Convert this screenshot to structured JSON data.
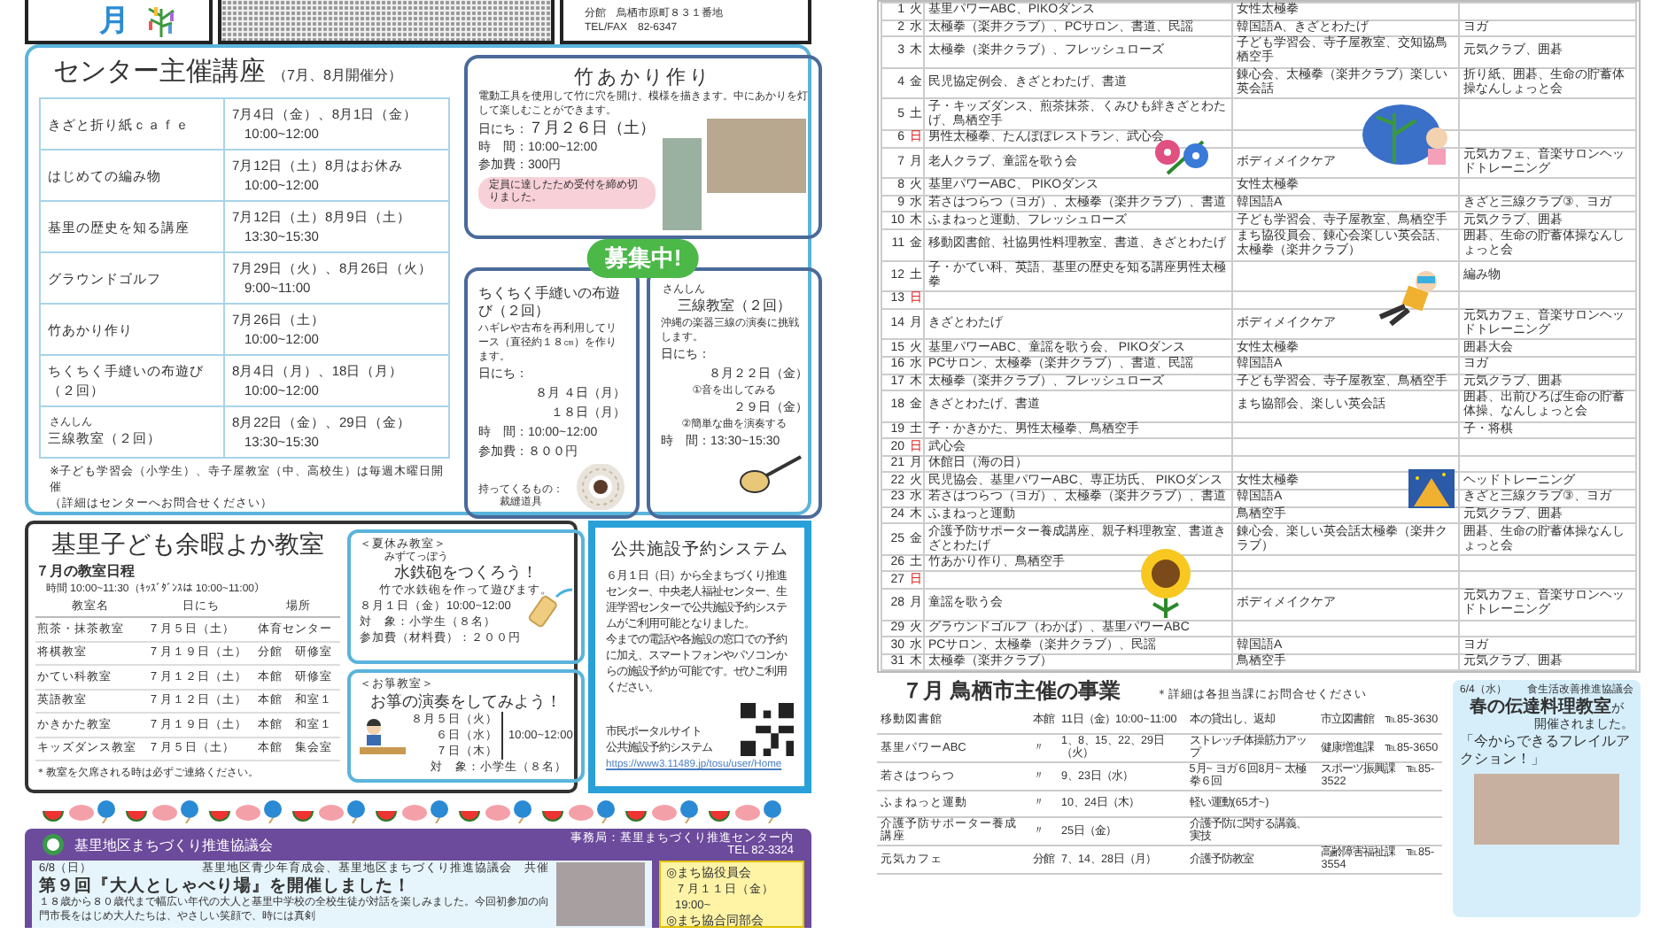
{
  "header": {
    "month": "月",
    "address": "分館　鳥栖市原町８３１番地",
    "tel": "TEL/FAX　82-6347"
  },
  "center_courses": {
    "title": "センター主催講座",
    "subtitle": "（7月、8月開催分）",
    "rows": [
      {
        "name": "きざと折り紙ｃａｆｅ",
        "dates": "7月4日（金）、8月1日（金）",
        "time": "10:00~12:00"
      },
      {
        "name": "はじめての編み物",
        "dates": "7月12日（土）8月はお休み",
        "time": "10:00~12:00"
      },
      {
        "name": "基里の歴史を知る講座",
        "dates": "7月12日（土）8月9日（土）",
        "time": "13:30~15:30"
      },
      {
        "name": "グラウンドゴルフ",
        "dates": "7月29日（火）、8月26日（火）",
        "time": "9:00~11:00"
      },
      {
        "name": "竹あかり作り",
        "dates": "7月26日（土）",
        "time": "10:00~12:00"
      },
      {
        "name": "ちくちく手縫いの布遊び（２回）",
        "dates": "8月4日（月）、18日（月）",
        "time": "10:00~12:00"
      },
      {
        "name_base": "三線",
        "name_ruby": "さんしん",
        "name": "教室（２回）",
        "dates": "8月22日（金）、29日（金）",
        "time": "13:30~15:30"
      }
    ],
    "notes": [
      "※子ども学習会（小学生）、寺子屋教室（中、高校生）は毎週木曜日開催",
      "（詳細はセンターへお問合せください）"
    ],
    "bamboo": {
      "title": "竹あかり作り",
      "desc": "電動工具を使用して竹に穴を開け、模様を描きます。中にあかりを灯して楽しむことができます。",
      "date_label": "日にち：",
      "date": "７月２６日（土）",
      "time": "時　間：10:00~12:00",
      "fee": "参加費：300円",
      "closed_note": "定員に達したため受付を締め切りました。"
    },
    "badge": "募集中!",
    "sewing": {
      "title": "ちくちく手縫いの布遊び（２回）",
      "desc": "ハギレや古布を再利用してリース（直径約１８㎝）を作ります。",
      "date_label": "日にち：",
      "dates": [
        "８月 ４日（月）",
        "１８日（月）"
      ],
      "time": "時　間：10:00~12:00",
      "fee": "参加費：８００円",
      "bring": "持ってくるもの：",
      "bring_item": "裁縫道具"
    },
    "sanshin": {
      "title_base": "三線",
      "title_ruby": "さんしん",
      "title": "教室（２回）",
      "desc": "沖縄の楽器三線の演奏に挑戦します。",
      "date_label": "日にち：",
      "sessions": [
        {
          "date": "８月２２日（金）",
          "note": "①音を出してみる"
        },
        {
          "date": "２９日（金）",
          "note": "②簡単な曲を演奏する"
        }
      ],
      "time": "時　間：13:30~15:30"
    }
  },
  "kids_classes": {
    "title": "基里子ども余暇よか教室",
    "subtitle": "７月の教室日程",
    "hours": "時間 10:00~11:30（ｷｯｽﾞﾀﾞﾝｽは 10:00~11:00）",
    "columns": [
      "教室名",
      "日にち",
      "場所"
    ],
    "rows": [
      [
        "煎茶・抹茶教室",
        "７月５日（土）",
        "体育センター"
      ],
      [
        "将棋教室",
        "７月１９日（土）",
        "分館　研修室"
      ],
      [
        "かてい科教室",
        "７月１２日（土）",
        "本館　研修室"
      ],
      [
        "英語教室",
        "７月１２日（土）",
        "本館　和室１"
      ],
      [
        "かきかた教室",
        "７月１９日（土）",
        "本館　和室１"
      ],
      [
        "キッズダンス教室",
        "７月５日（土）",
        "本館　集会室"
      ]
    ],
    "note": "＊教室を欠席される時は必ずご連絡ください。",
    "summer": {
      "tag": "＜夏休み教室＞",
      "title_base": "水鉄砲",
      "title_ruby": "みずてっぽう",
      "title": "をつくろう！",
      "desc": "竹で水鉄砲を作って遊びます。",
      "date": "８月１日（金）10:00~12:00",
      "target": "対　象：小学生（８名）",
      "fee": "参加費（材料費）：２００円"
    },
    "koto": {
      "tag": "＜お箏教室＞",
      "title": "お箏の演奏をしてみよう！",
      "dates": [
        "８月５日（火）",
        "６日（水）",
        "７日（木）"
      ],
      "time": "10:00~12:00",
      "target": "対　象：小学生（８名）"
    }
  },
  "booking": {
    "title": "公共施設予約システム",
    "paragraphs": [
      "６月１日（日）から全まちづくり推進センター、中央老人福祉センター、生涯学習センターで公共施設予約システムがご利用可能となりました。",
      "今までの電話や各施設の窓口での予約に加え、スマートフォンやパソコンからの施設予約が可能です。ぜひご利用ください。"
    ],
    "portal": [
      "市民ポータルサイト",
      "公共施設予約システム"
    ],
    "url": "https://www3.11489.jp/tosu/user/Home"
  },
  "council": {
    "title": "基里地区まちづくり推進協議会",
    "office": "事務局：基里まちづくり推進センター内",
    "tel": "TEL 82-3324",
    "article": {
      "date": "6/8（日）",
      "organizers": "基里地区青少年育成会、基里地区まちづくり推進協議会　共催",
      "headline": "第９回『大人としゃべり場』を開催しました！",
      "body": "１８歳から８０歳代まで幅広い年代の大人と基里中学校の全校生徒が対話を楽しみました。今回初参加の向門市長をはじめ大人たちは、やさしい笑顔で、時には真剣"
    },
    "schedule": [
      {
        "title": "◎まち協役員会",
        "when": "７月１１日（金）19:00~"
      },
      {
        "title": "◎まち協合同部会"
      }
    ]
  },
  "calendar": [
    {
      "day": "1",
      "weekday": "火",
      "sunday": false,
      "column_3": "基里パワーABC、PIKOダンス",
      "column_4": "女性太極拳"
    },
    {
      "day": "2",
      "weekday": "水",
      "sunday": false,
      "column_3": "太極拳（楽井クラブ）、PCサロン、書道、民謡",
      "column_4": "韓国語A、きざとわたげ",
      "column_5": "ヨガ"
    },
    {
      "day": "3",
      "weekday": "木",
      "sunday": false,
      "column_3": "太極拳（楽井クラブ）、フレッシュローズ",
      "column_4": "子ども学習会、寺子屋教室、交知協鳥栖空手",
      "column_5": "元気クラブ、囲碁"
    },
    {
      "day": "4",
      "weekday": "金",
      "sunday": false,
      "column_3": "民児協定例会、きざとわたげ、書道",
      "column_4": "錬心会、太極拳（楽井クラブ）楽しい英会話",
      "column_5": "折り紙、囲碁、生命の貯蓄体操なんしょっと会"
    },
    {
      "day": "5",
      "weekday": "土",
      "sunday": false,
      "column_3": "子・キッズダンス、煎茶抹茶、くみひも絆きざとわたげ、鳥栖空手"
    },
    {
      "day": "6",
      "weekday": "日",
      "sunday": true,
      "column_3": "男性太極拳、たんぽぽレストラン、武心会"
    },
    {
      "day": "7",
      "weekday": "月",
      "sunday": false,
      "column_3": "老人クラブ、童謡を歌う会",
      "column_4": "ボディメイクケア",
      "column_5": "元気カフェ、音楽サロンヘッドトレーニング"
    },
    {
      "day": "8",
      "weekday": "火",
      "sunday": false,
      "column_3": "基里パワーABC、 PIKOダンス",
      "column_4": "女性太極拳"
    },
    {
      "day": "9",
      "weekday": "水",
      "sunday": false,
      "column_3": "若さはつらつ（ヨガ）、太極拳（楽井クラブ）、書道",
      "column_4": "韓国語A",
      "column_5": "きざと三線クラブ③、ヨガ"
    },
    {
      "day": "10",
      "weekday": "木",
      "sunday": false,
      "column_3": "ふまねっと運動、フレッシュローズ",
      "column_4": "子ども学習会、寺子屋教室、鳥栖空手",
      "column_5": "元気クラブ、囲碁"
    },
    {
      "day": "11",
      "weekday": "金",
      "sunday": false,
      "column_3": "移動図書館、社協男性料理教室、書道、きざとわたげ",
      "column_4": "まち協役員会、錬心会楽しい英会話、太極拳（楽井クラブ）",
      "column_5": "囲碁、生命の貯蓄体操なんしょっと会"
    },
    {
      "day": "12",
      "weekday": "土",
      "sunday": false,
      "column_3": "子・かてい科、英語、基里の歴史を知る講座男性太極拳",
      "column_5": "編み物"
    },
    {
      "day": "13",
      "weekday": "日",
      "sunday": true
    },
    {
      "day": "14",
      "weekday": "月",
      "sunday": false,
      "column_3": "きざとわたげ",
      "column_4": "ボディメイクケア",
      "column_5": "元気カフェ、音楽サロンヘッドトレーニング"
    },
    {
      "day": "15",
      "weekday": "火",
      "sunday": false,
      "column_3": "基里パワーABC、童謡を歌う会、 PIKOダンス",
      "column_4": "女性太極拳",
      "column_5": "囲碁大会"
    },
    {
      "day": "16",
      "weekday": "水",
      "sunday": false,
      "column_3": "PCサロン、太極拳（楽井クラブ）、書道、民謡",
      "column_4": "韓国語A",
      "column_5": "ヨガ"
    },
    {
      "day": "17",
      "weekday": "木",
      "sunday": false,
      "column_3": "太極拳（楽井クラブ）、フレッシュローズ",
      "column_4": "子ども学習会、寺子屋教室、鳥栖空手",
      "column_5": "元気クラブ、囲碁"
    },
    {
      "day": "18",
      "weekday": "金",
      "sunday": false,
      "column_3": "きざとわたげ、書道",
      "column_4": "まち協部会、楽しい英会話",
      "column_5": "囲碁、出前ひろば生命の貯蓄体操、なんしょっと会"
    },
    {
      "day": "19",
      "weekday": "土",
      "sunday": false,
      "column_3": "子・かきかた、男性太極拳、鳥栖空手",
      "column_5": "子・将棋"
    },
    {
      "day": "20",
      "weekday": "日",
      "sunday": true,
      "column_3": "武心会"
    },
    {
      "day": "21",
      "weekday": "月",
      "sunday": false,
      "column_3": "休館日（海の日）"
    },
    {
      "day": "22",
      "weekday": "火",
      "sunday": false,
      "column_3": "民児協会、基里パワーABC、専正坊氏、 PIKOダンス",
      "column_4": "女性太極拳",
      "column_5": "ヘッドトレーニング"
    },
    {
      "day": "23",
      "weekday": "水",
      "sunday": false,
      "column_3": "若さはつらつ（ヨガ）、太極拳（楽井クラブ）、書道",
      "column_4": "韓国語A",
      "column_5": "きざと三線クラブ③、ヨガ"
    },
    {
      "day": "24",
      "weekday": "木",
      "sunday": false,
      "column_3": "ふまねっと運動",
      "column_4": "鳥栖空手",
      "column_5": "元気クラブ、囲碁"
    },
    {
      "day": "25",
      "weekday": "金",
      "sunday": false,
      "column_3": "介護予防サポーター養成講座、親子料理教室、書道きざとわたげ",
      "column_4": "錬心会、楽しい英会話太極拳（楽井クラブ）",
      "column_5": "囲碁、生命の貯蓄体操なんしょっと会"
    },
    {
      "day": "26",
      "weekday": "土",
      "sunday": false,
      "column_3": "竹あかり作り、鳥栖空手"
    },
    {
      "day": "27",
      "weekday": "日",
      "sunday": true
    },
    {
      "day": "28",
      "weekday": "月",
      "sunday": false,
      "column_3": "童謡を歌う会",
      "column_4": "ボディメイクケア",
      "column_5": "元気カフェ、音楽サロンヘッドトレーニング"
    },
    {
      "day": "29",
      "weekday": "火",
      "sunday": false,
      "column_3": "グラウンドゴルフ（わかば）、基里パワーABC"
    },
    {
      "day": "30",
      "weekday": "水",
      "sunday": false,
      "column_3": "PCサロン、太極拳（楽井クラブ）、民謡",
      "column_4": "韓国語A",
      "column_5": "ヨガ"
    },
    {
      "day": "31",
      "weekday": "木",
      "sunday": false,
      "column_3": "太極拳（楽井クラブ）",
      "column_4": "鳥栖空手",
      "column_5": "元気クラブ、囲碁"
    }
  ],
  "city_events": {
    "title": "７月 鳥栖市主催の事業",
    "note": "＊詳細は各担当課にお問合せください",
    "rows": [
      {
        "name": "移動図書館",
        "place": "本館",
        "date": "11日（金）10:00~11:00",
        "content": "本の貸出し、返却",
        "contact": "市立図書館　℡85-3630"
      },
      {
        "name": "基里パワーABC",
        "place": "〃",
        "date": "1、8、15、22、29日（火）",
        "content": "ストレッチ体操筋力アップ",
        "contact": "健康増進課　℡85-3650"
      },
      {
        "name": "若さはつらつ",
        "place": "〃",
        "date": "9、23日（水）",
        "content": "5月~ ヨガ６回8月~ 太極拳６回",
        "contact": "スポーツ振興課　℡85-3522"
      },
      {
        "name": "ふまねっと運動",
        "place": "〃",
        "date": "10、24日（木）",
        "content": "軽い運動(65才~)"
      },
      {
        "name": "介護予防サポーター養成講座",
        "place": "〃",
        "date": "25日（金）",
        "content": "介護予防に関する講義、実技"
      },
      {
        "name": "元気カフェ",
        "place": "分館",
        "date": "7、14、28日（月）",
        "content": "介護予防教室",
        "contact": "高齢障害福祉課　℡85-3554"
      }
    ]
  },
  "food_class": {
    "date": "6/4（水）",
    "org": "食生活改善推進協議会",
    "headline": "春の伝達料理教室",
    "headline_suffix": "が",
    "line2": "開催されました。",
    "quote": "「今からできるフレイルアクション！」"
  }
}
